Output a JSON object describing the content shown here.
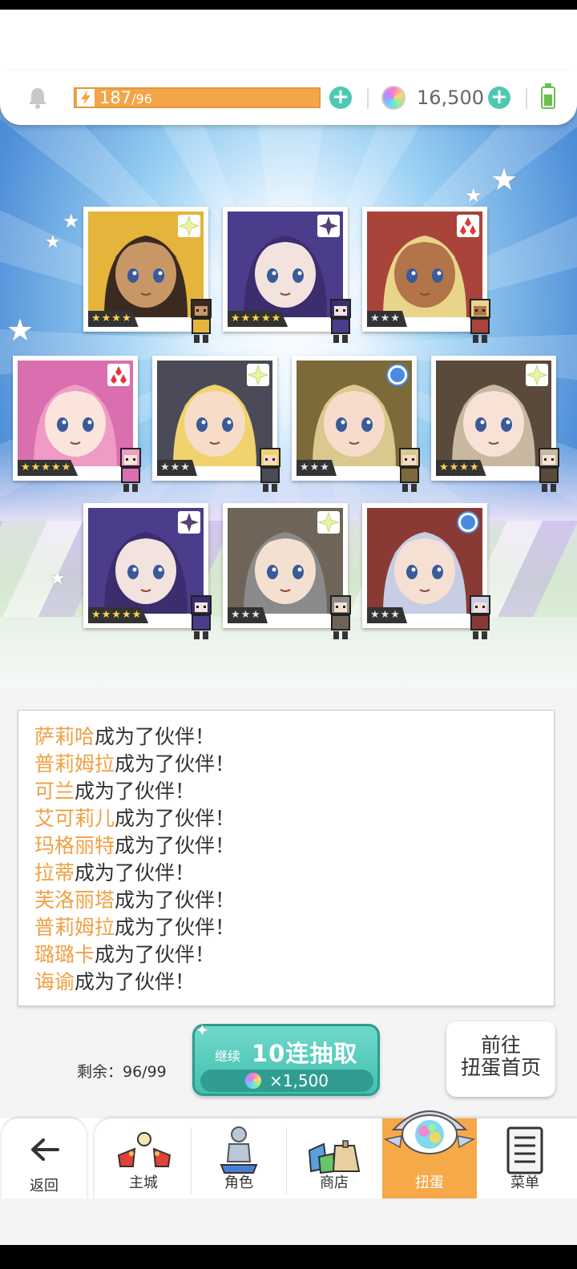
{
  "header": {
    "stamina_current": "187",
    "stamina_max": "/96",
    "gems": "16,500"
  },
  "cards": [
    {
      "name": "萨莉哈",
      "rarity": "★★★★",
      "rarity_level": 4,
      "attr": "star",
      "bg": "#e5b43b",
      "hair": "#3b2a20",
      "skin": "#c79866"
    },
    {
      "name": "普莉姆拉",
      "rarity": "★★★★★",
      "rarity_level": 5,
      "attr": "dark",
      "bg": "#4b3c8c",
      "hair": "#3b2d6e",
      "skin": "#f3e3de"
    },
    {
      "name": "可兰",
      "rarity": "★★★",
      "rarity_level": 3,
      "attr": "fire",
      "bg": "#a8443a",
      "hair": "#e9d58a",
      "skin": "#b27448"
    },
    {
      "name": "艾可莉儿",
      "rarity": "★★★★★",
      "rarity_level": 5,
      "attr": "fire",
      "bg": "#d96fae",
      "hair": "#f09ac6",
      "skin": "#fbe4dc"
    },
    {
      "name": "玛格丽特",
      "rarity": "★★★",
      "rarity_level": 3,
      "attr": "star",
      "bg": "#4a4a58",
      "hair": "#f0d36c",
      "skin": "#f7dcc8"
    },
    {
      "name": "拉蒂",
      "rarity": "★★★",
      "rarity_level": 3,
      "attr": "water",
      "bg": "#7d6a3a",
      "hair": "#d9c98f",
      "skin": "#f7dccb"
    },
    {
      "name": "芙洛丽塔",
      "rarity": "★★★★",
      "rarity_level": 4,
      "attr": "star",
      "bg": "#5a4a3c",
      "hair": "#c8b8a0",
      "skin": "#f8e2d6"
    },
    {
      "name": "普莉姆拉",
      "rarity": "★★★★★",
      "rarity_level": 5,
      "attr": "dark",
      "bg": "#4b3c8c",
      "hair": "#3b2d6e",
      "skin": "#f3e3de"
    },
    {
      "name": "璐璐卡",
      "rarity": "★★★",
      "rarity_level": 3,
      "attr": "star",
      "bg": "#6e6558",
      "hair": "#8a8a8a",
      "skin": "#f4e0d0"
    },
    {
      "name": "诲谕",
      "rarity": "★★★",
      "rarity_level": 3,
      "attr": "water",
      "bg": "#8a3a34",
      "hair": "#c7cde4",
      "skin": "#f6e0d4"
    }
  ],
  "log": [
    {
      "name": "萨莉哈",
      "suffix": "成为了伙伴！"
    },
    {
      "name": "普莉姆拉",
      "suffix": "成为了伙伴！"
    },
    {
      "name": "可兰",
      "suffix": "成为了伙伴！"
    },
    {
      "name": "艾可莉儿",
      "suffix": "成为了伙伴！"
    },
    {
      "name": "玛格丽特",
      "suffix": "成为了伙伴！"
    },
    {
      "name": "拉蒂",
      "suffix": "成为了伙伴！"
    },
    {
      "name": "芙洛丽塔",
      "suffix": "成为了伙伴！"
    },
    {
      "name": "普莉姆拉",
      "suffix": "成为了伙伴！"
    },
    {
      "name": "璐璐卡",
      "suffix": "成为了伙伴！"
    },
    {
      "name": "诲谕",
      "suffix": "成为了伙伴！"
    }
  ],
  "action": {
    "remaining": "剩余：96/99",
    "continue_label": "继续",
    "draw_label": "10连抽取",
    "cost": "×1,500",
    "home_line1": "前往",
    "home_line2": "扭蛋首页"
  },
  "nav": {
    "back": "返回",
    "items": [
      {
        "label": "主城",
        "icon": "castle-icon"
      },
      {
        "label": "角色",
        "icon": "character-icon"
      },
      {
        "label": "商店",
        "icon": "shop-icon"
      },
      {
        "label": "扭蛋",
        "icon": "gacha-icon",
        "active": true
      },
      {
        "label": "菜单",
        "icon": "menu-icon"
      }
    ]
  },
  "colors": {
    "accent": "#4cc9b3",
    "stamina": "#f3a54a",
    "name_highlight": "#f0a042",
    "nav_active": "#f6a948"
  }
}
